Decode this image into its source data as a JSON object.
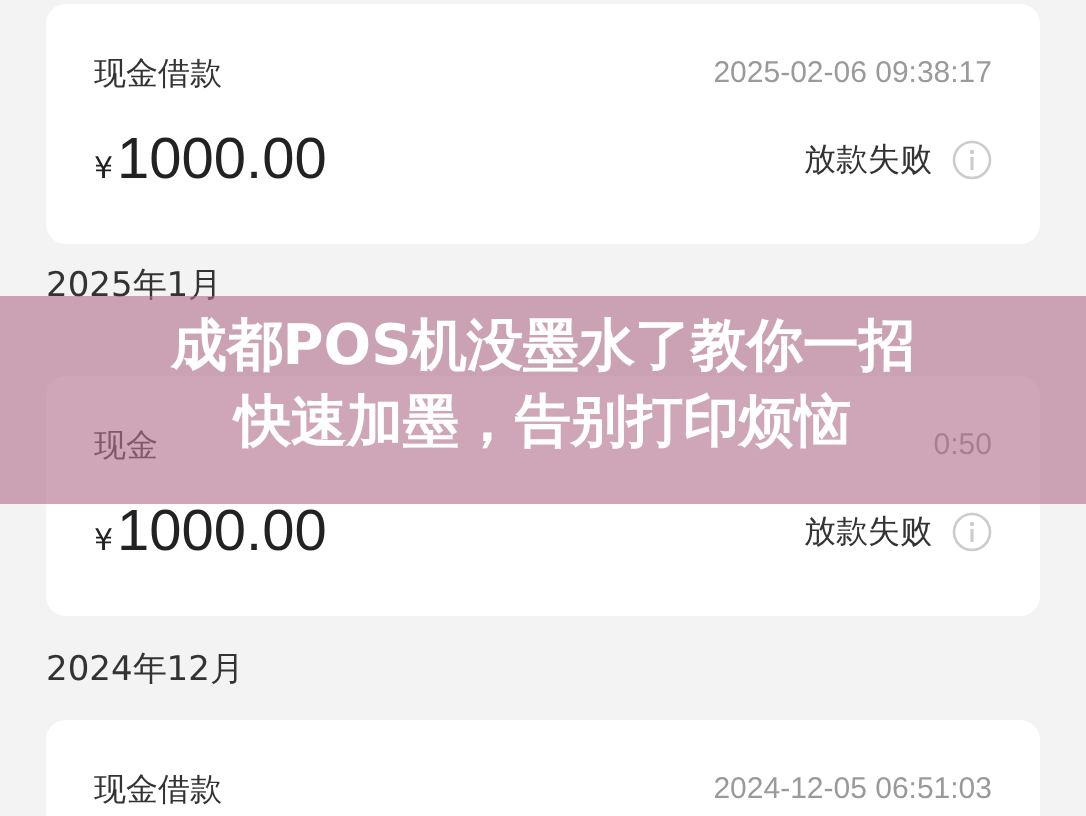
{
  "items": [
    {
      "kind": "card",
      "title": "现金借款",
      "time": "2025-02-06 09:38:17",
      "currency": "¥",
      "amount": "1000.00",
      "status": "放款失败"
    },
    {
      "kind": "month",
      "label": "2025年1月"
    },
    {
      "kind": "card",
      "title": "现金",
      "time": "0:50",
      "currency": "¥",
      "amount": "1000.00",
      "status": "放款失败"
    },
    {
      "kind": "month",
      "label": "2024年12月"
    },
    {
      "kind": "card",
      "title": "现金借款",
      "time": "2024-12-05 06:51:03"
    }
  ],
  "headline": [
    "成都POS机没墨水了教你一招",
    "快速加墨，告别打印烦恼"
  ]
}
